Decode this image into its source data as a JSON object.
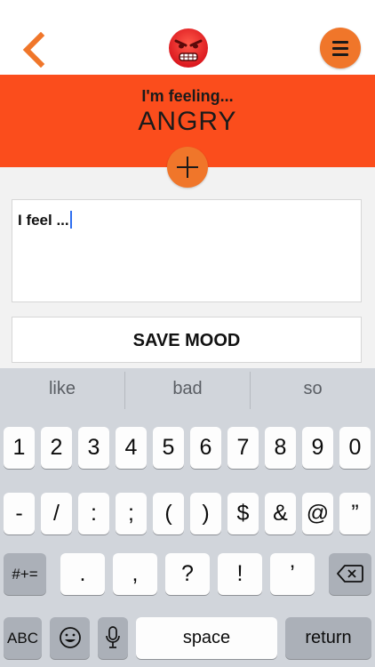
{
  "header": {
    "back_icon": "chevron-left-icon",
    "emoji_icon": "angry-face-icon",
    "menu_icon": "menu-icon",
    "accent_color": "#f0762a"
  },
  "mood": {
    "label": "I'm feeling...",
    "name": "ANGRY",
    "banner_color": "#fb4d1c",
    "add_icon": "plus-icon"
  },
  "note": {
    "value": "I feel ..."
  },
  "save_button": {
    "label": "SAVE MOOD"
  },
  "keyboard": {
    "suggestions": [
      "like",
      "bad",
      "so"
    ],
    "row1": [
      "1",
      "2",
      "3",
      "4",
      "5",
      "6",
      "7",
      "8",
      "9",
      "0"
    ],
    "row2": [
      "-",
      "/",
      ":",
      ";",
      "(",
      ")",
      "$",
      "&",
      "@",
      "”"
    ],
    "row3_left": "#+=",
    "row3": [
      ".",
      ",",
      "?",
      "!",
      "’"
    ],
    "backspace_icon": "backspace-icon",
    "row4": {
      "abc": "ABC",
      "emoji_icon": "emoji-icon",
      "mic_icon": "microphone-icon",
      "space": "space",
      "return": "return"
    }
  }
}
